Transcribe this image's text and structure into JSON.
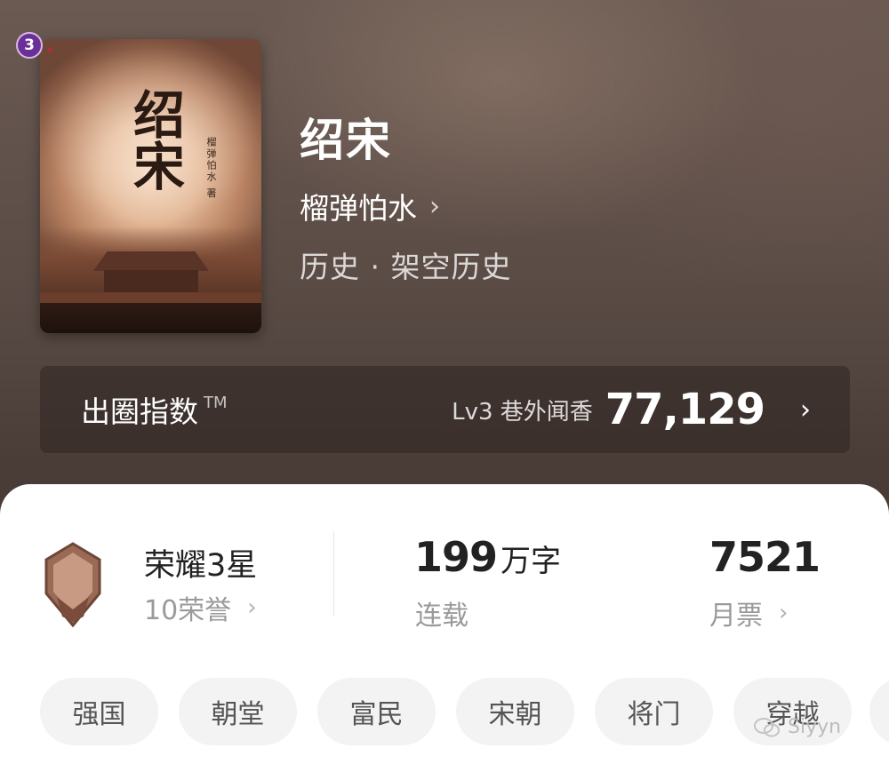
{
  "book": {
    "title": "绍宋",
    "author": "榴弹怕水",
    "genre": "历史 · 架空历史",
    "cover_title": "绍宋",
    "cover_author": "榴弹怕水 著"
  },
  "index_bar": {
    "label": "出圈指数",
    "trademark": "TM",
    "level": "Lv3 巷外闻香",
    "score": "77,129"
  },
  "stats": {
    "honor": {
      "badge_number": "3",
      "title": "荣耀3星",
      "subtitle": "10荣誉"
    },
    "words": {
      "number": "199",
      "unit": "万字",
      "label": "连载"
    },
    "monthly_tickets": {
      "number": "7521",
      "label": "月票"
    }
  },
  "tags": [
    "强国",
    "朝堂",
    "富民",
    "宋朝",
    "将门",
    "穿越"
  ],
  "watermark": "Siyyn",
  "icons": {
    "chevron": "›",
    "wechat": "wechat-icon"
  },
  "colors": {
    "badge_purple": "#6b2f98",
    "tag_bg": "#f3f3f3"
  }
}
